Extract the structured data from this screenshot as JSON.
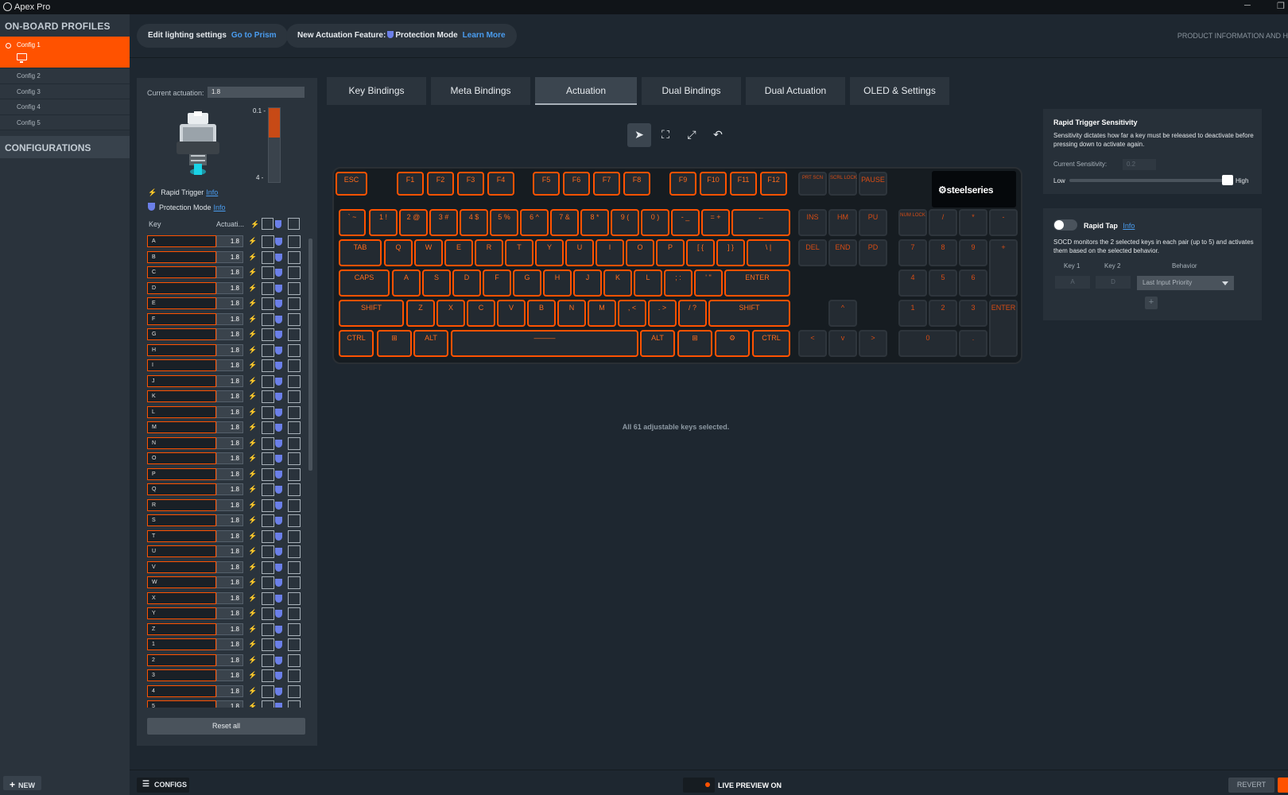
{
  "app": {
    "title": "Apex Pro"
  },
  "sidebar": {
    "onboard_title": "ON-BOARD PROFILES",
    "configs": [
      "Config 1",
      "Config 2",
      "Config 3",
      "Config 4",
      "Config 5"
    ],
    "configurations_title": "CONFIGURATIONS",
    "new_label": "NEW"
  },
  "topbar": {
    "edit_lighting": "Edit lighting settings",
    "go_to_prism": "Go to Prism",
    "new_feature": "New Actuation Feature:",
    "protection_mode": "Protection Mode",
    "learn_more": "Learn More",
    "product_info": "PRODUCT INFORMATION AND H"
  },
  "left_panel": {
    "current_actuation_label": "Current actuation:",
    "current_actuation_value": "1.8",
    "scale_top": "0.1 -",
    "scale_bottom": "4 -",
    "actuation_level": 0.4,
    "rapid_trigger": "Rapid Trigger",
    "protection_mode": "Protection Mode",
    "info": "Info",
    "col_key": "Key",
    "col_actuation": "Actuati...",
    "keys": [
      "A",
      "B",
      "C",
      "D",
      "E",
      "F",
      "G",
      "H",
      "I",
      "J",
      "K",
      "L",
      "M",
      "N",
      "O",
      "P",
      "Q",
      "R",
      "S",
      "T",
      "U",
      "V",
      "W",
      "X",
      "Y",
      "Z",
      "1",
      "2",
      "3",
      "4",
      "5"
    ],
    "value": "1.8",
    "reset_all": "Reset all"
  },
  "tabs": [
    "Key Bindings",
    "Meta Bindings",
    "Actuation",
    "Dual Bindings",
    "Dual Actuation",
    "OLED & Settings"
  ],
  "active_tab": "Actuation",
  "tools": [
    "cursor-icon",
    "marquee-select-icon",
    "expand-icon",
    "undo-icon"
  ],
  "keyboard": {
    "brand": "steelseries",
    "status": "All 61 adjustable keys selected.",
    "color": "#ff5200"
  },
  "rapid_trigger_panel": {
    "title": "Rapid Trigger Sensitivity",
    "description": "Sensitivity dictates how far a key must be released to deactivate before pressing down to activate again.",
    "current_label": "Current Sensitivity:",
    "current_value": "0.2",
    "low": "Low",
    "high": "High",
    "sensitivity_level": 0.97
  },
  "rapid_tap_panel": {
    "title": "Rapid Tap",
    "info": "Info",
    "description": "SOCD monitors the 2 selected keys in each pair (up to 5) and activates them based on the selected behavior.",
    "key1_label": "Key 1",
    "key2_label": "Key 2",
    "behavior_label": "Behavior",
    "key1": "A",
    "key2": "D",
    "behavior": "Last Input Priority",
    "add": "+"
  },
  "bottombar": {
    "configs": "CONFIGS",
    "live_preview": "LIVE PREVIEW ON",
    "revert": "REVERT"
  }
}
